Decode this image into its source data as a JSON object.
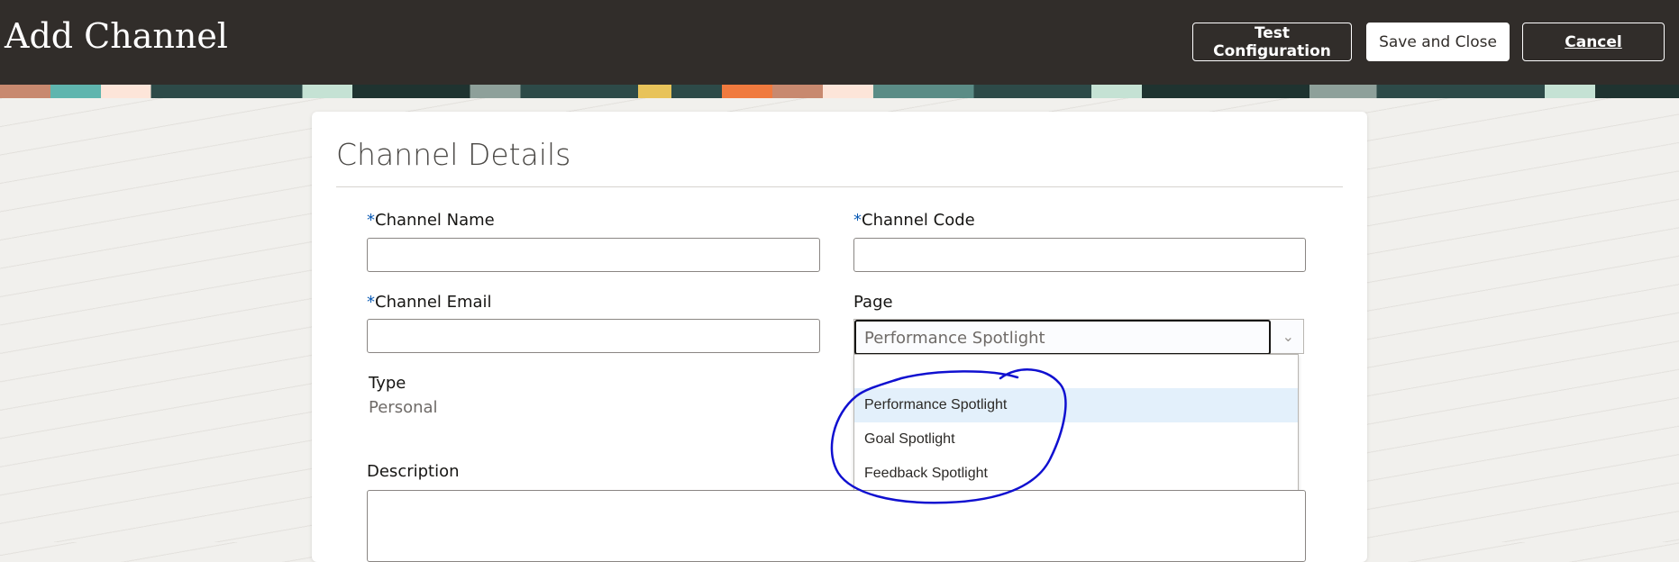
{
  "header": {
    "title": "Add Channel",
    "test_configuration": "Test Configuration",
    "save_and_close": "Save and Close",
    "cancel": "Cancel"
  },
  "card": {
    "title": "Channel Details"
  },
  "form": {
    "required_marker": "*",
    "channel_name": {
      "label": "Channel Name",
      "value": ""
    },
    "channel_code": {
      "label": "Channel Code",
      "value": ""
    },
    "channel_email": {
      "label": "Channel Email",
      "value": ""
    },
    "page": {
      "label": "Page",
      "value": "Performance Spotlight",
      "options": [
        "Performance Spotlight",
        "Goal Spotlight",
        "Feedback Spotlight"
      ]
    },
    "type": {
      "label": "Type",
      "value": "Personal"
    },
    "description": {
      "label": "Description",
      "value": ""
    }
  },
  "annotation_color": "#1010d0"
}
